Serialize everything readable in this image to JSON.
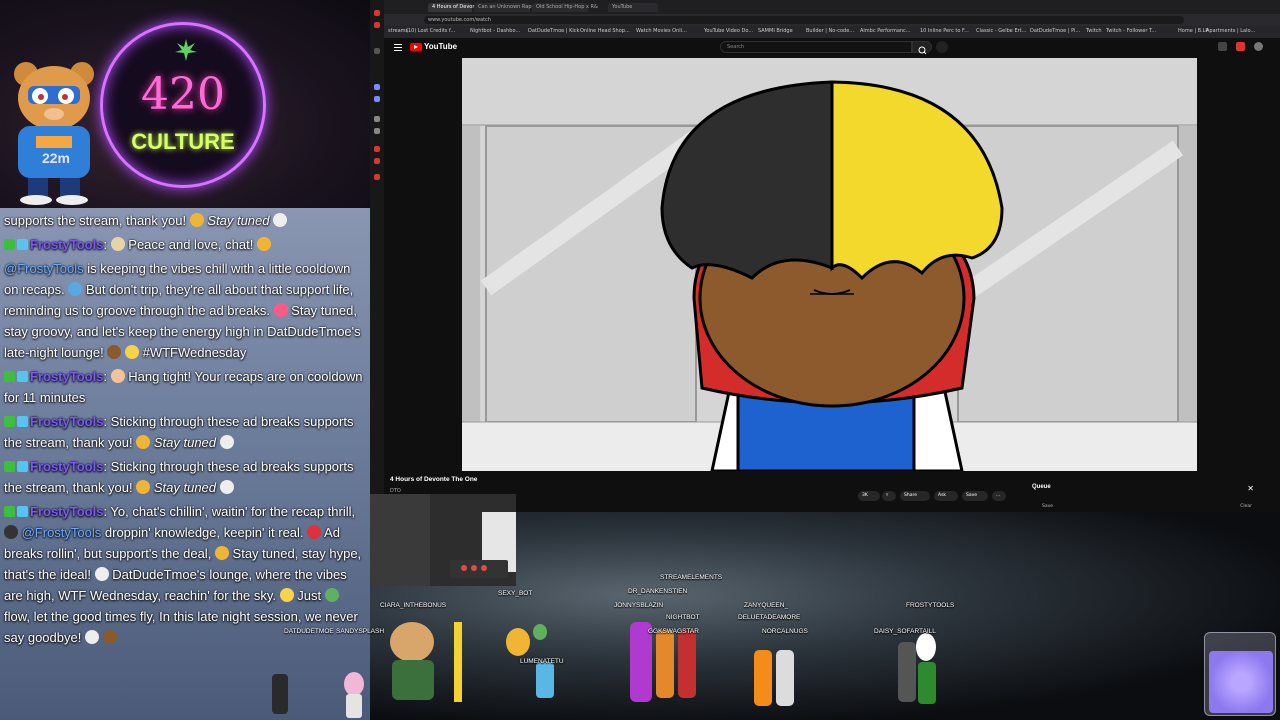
{
  "overlay": {
    "mascot_timer": "22m",
    "neon_number": "420",
    "neon_word": "CULTURE"
  },
  "chat": {
    "messages": [
      {
        "parts": [
          {
            "t": "text",
            "v": "supports the stream, thank you! "
          },
          {
            "t": "emoji",
            "c": "#f1b534"
          },
          {
            "t": "em",
            "v": " Stay tuned "
          },
          {
            "t": "emoji",
            "c": "#eeeeee"
          }
        ]
      },
      {
        "user": "FrostyTools",
        "parts": [
          {
            "t": "text",
            "v": ": "
          },
          {
            "t": "emoji",
            "c": "#e6d3a6"
          },
          {
            "t": "text",
            "v": " Peace and love, chat! "
          },
          {
            "t": "emoji",
            "c": "#f1b534"
          }
        ]
      },
      {
        "parts": [
          {
            "t": "mention",
            "v": "@FrostyTools"
          },
          {
            "t": "text",
            "v": " is keeping the vibes chill with a little cooldown on recaps. "
          },
          {
            "t": "emoji",
            "c": "#58a8e6"
          },
          {
            "t": "text",
            "v": " But don't trip, they're all about that support life, reminding us to groove through the ad breaks. "
          },
          {
            "t": "emoji",
            "c": "#ff5a86"
          },
          {
            "t": "text",
            "v": " Stay tuned, stay groovy, and let's keep the energy high in DatDudeTmoe's late-night lounge! "
          },
          {
            "t": "emoji",
            "c": "#8a5a2a"
          },
          {
            "t": "text",
            "v": " "
          },
          {
            "t": "emoji",
            "c": "#f7d34a"
          },
          {
            "t": "text",
            "v": " #WTFWednesday"
          }
        ]
      },
      {
        "user": "FrostyTools",
        "parts": [
          {
            "t": "text",
            "v": ": "
          },
          {
            "t": "emoji",
            "c": "#f2c29a"
          },
          {
            "t": "text",
            "v": " Hang tight! Your recaps are on cooldown for 11 minutes"
          }
        ]
      },
      {
        "user": "FrostyTools",
        "parts": [
          {
            "t": "text",
            "v": ": Sticking through these ad breaks supports the stream, thank you! "
          },
          {
            "t": "emoji",
            "c": "#f1b534"
          },
          {
            "t": "em",
            "v": " Stay tuned "
          },
          {
            "t": "emoji",
            "c": "#eeeeee"
          }
        ]
      },
      {
        "user": "FrostyTools",
        "parts": [
          {
            "t": "text",
            "v": ": Sticking through these ad breaks supports the stream, thank you! "
          },
          {
            "t": "emoji",
            "c": "#f1b534"
          },
          {
            "t": "em",
            "v": " Stay tuned "
          },
          {
            "t": "emoji",
            "c": "#eeeeee"
          }
        ]
      },
      {
        "user": "FrostyTools",
        "parts": [
          {
            "t": "text",
            "v": ": Yo, chat's chillin', waitin' for the recap thrill, "
          },
          {
            "t": "emoji",
            "c": "#333333"
          },
          {
            "t": "mention",
            "v": " @FrostyTools"
          },
          {
            "t": "text",
            "v": " droppin' knowledge, keepin' it real. "
          },
          {
            "t": "emoji",
            "c": "#e0303a"
          },
          {
            "t": "text",
            "v": " Ad breaks rollin', but support's the deal, "
          },
          {
            "t": "emoji",
            "c": "#f1b534"
          },
          {
            "t": "text",
            "v": " Stay tuned, stay hype, that's the ideal! "
          },
          {
            "t": "emoji",
            "c": "#eeeeee"
          },
          {
            "t": "text",
            "v": " DatDudeTmoe's lounge, where the vibes are high, WTF Wednesday, reachin' for the sky. "
          },
          {
            "t": "emoji",
            "c": "#f7d34a"
          },
          {
            "t": "text",
            "v": " Just "
          },
          {
            "t": "emoji",
            "c": "#5fb05f"
          },
          {
            "t": "text",
            "v": " flow, let the good times fly, In this late night session, we never say goodbye! "
          },
          {
            "t": "emoji",
            "c": "#eeeeee"
          },
          {
            "t": "text",
            "v": " "
          },
          {
            "t": "emoji",
            "c": "#8a5a2a"
          }
        ]
      }
    ]
  },
  "browser": {
    "tabs": [
      "4 Hours of Devonte The",
      "Can an Unknown Rapper",
      "Old School Hip-Hop x R&",
      "YouTube"
    ],
    "url": "www.youtube.com/watch",
    "bookmarks": [
      "streams",
      "(10) Lost Credits f...",
      "Nightbot - Dashbo...",
      "DatDudeTmoe | Kick",
      "Online Head Shop...",
      "Watch Movies Onli...",
      "YouTube Video Do...",
      "SAMMI Bridge",
      "Builder | No-code...",
      "Aimbc Performanc...",
      "10 Inline Perc to F...",
      "Classic - Gelbe Ert...",
      "DatDudeTmoe | Pi...",
      "Twitch",
      "Twitch - Follower T...",
      "Home | B.LP",
      "Apartments | Lalo..."
    ]
  },
  "youtube": {
    "wordmark": "YouTube",
    "search_placeholder": "Search",
    "video_title": "4 Hours of Devonte The One",
    "channel": "DTO",
    "actions": {
      "like": "3K",
      "share": "Share",
      "ask": "Ask",
      "save": "Save",
      "more": "..."
    },
    "queue": {
      "title": "Queue",
      "close": "✕",
      "save": "Save",
      "clear": "Clear"
    }
  },
  "stage": {
    "viewers": [
      {
        "name": "STREAMELEMENTS"
      },
      {
        "name": "DR_DANKENSTIEN"
      },
      {
        "name": "CIARA_INTHEBONUS"
      },
      {
        "name": "JONNYSBLAZIN"
      },
      {
        "name": "SEXY_BOT"
      },
      {
        "name": "ZANYQUEEN_"
      },
      {
        "name": "FROSTYTOOLS"
      },
      {
        "name": "NIGHTBOT"
      },
      {
        "name": "DELUETADEAMORE"
      },
      {
        "name": "GGKSWAGSTAR"
      },
      {
        "name": "NORCALNUGS"
      },
      {
        "name": "DAISY_SOFARTAILL"
      },
      {
        "name": "DATDUDETMOE"
      },
      {
        "name": "SANDYSPLASH"
      },
      {
        "name": "LUMENATETU"
      }
    ]
  }
}
